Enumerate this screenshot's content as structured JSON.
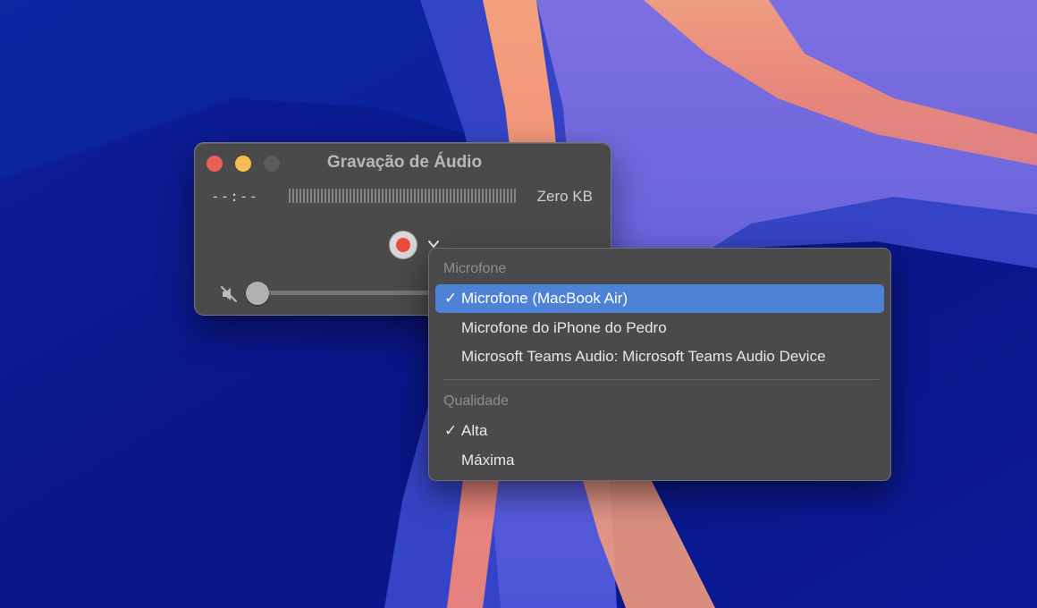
{
  "window": {
    "title": "Gravação de Áudio",
    "timecode": "--:--",
    "file_size": "Zero KB"
  },
  "menu": {
    "section_microphone": "Microfone",
    "microphones": [
      {
        "label": "Microfone (MacBook Air)",
        "checked": true,
        "highlighted": true
      },
      {
        "label": "Microfone do iPhone do Pedro",
        "checked": false
      },
      {
        "label": "Microsoft Teams Audio: Microsoft Teams Audio Device",
        "checked": false
      }
    ],
    "section_quality": "Qualidade",
    "qualities": [
      {
        "label": "Alta",
        "checked": true
      },
      {
        "label": "Máxima",
        "checked": false
      }
    ],
    "check_glyph": "✓"
  },
  "colors": {
    "record": "#ec4b3f",
    "highlight": "#4e82d6",
    "close": "#ec5f56",
    "minimize": "#f3bd4f"
  },
  "icons": {
    "record": "record-icon",
    "options": "chevron-down-icon",
    "mute": "speaker-muted-icon"
  }
}
